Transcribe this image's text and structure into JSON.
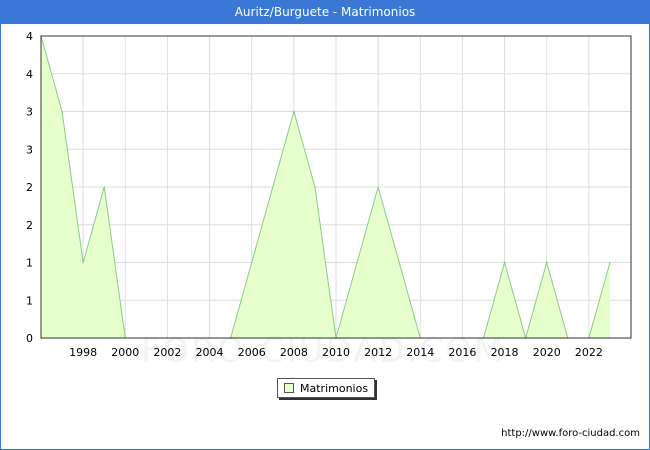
{
  "header": {
    "title": "Auritz/Burguete - Matrimonios"
  },
  "legend": {
    "label": "Matrimonios"
  },
  "footer": {
    "source_url": "http://www.foro-ciudad.com",
    "watermark": "FORO-CIUDAD.COM"
  },
  "colors": {
    "titlebar": "#3a78d6",
    "fill": "#e6ffcc",
    "line": "#88cc88",
    "grid": "#dddddd"
  },
  "chart_data": {
    "type": "area",
    "title": "Auritz/Burguete - Matrimonios",
    "xlabel": "",
    "ylabel": "",
    "x": [
      1996,
      1997,
      1998,
      1999,
      2000,
      2001,
      2002,
      2003,
      2004,
      2005,
      2006,
      2007,
      2008,
      2009,
      2010,
      2011,
      2012,
      2013,
      2014,
      2015,
      2016,
      2017,
      2018,
      2019,
      2020,
      2021,
      2022,
      2023
    ],
    "series": [
      {
        "name": "Matrimonios",
        "values": [
          4,
          3,
          1,
          2,
          0,
          0,
          0,
          0,
          0,
          0,
          1,
          2,
          3,
          2,
          0,
          1,
          2,
          1,
          0,
          0,
          0,
          0,
          1,
          0,
          1,
          0,
          0,
          1
        ]
      }
    ],
    "xlim": [
      1996,
      2024
    ],
    "ylim": [
      0,
      4
    ],
    "x_ticks": [
      "1998",
      "2000",
      "2002",
      "2004",
      "2006",
      "2008",
      "2010",
      "2012",
      "2014",
      "2016",
      "2018",
      "2020",
      "2022"
    ],
    "y_tick_labels": [
      "0",
      "1",
      "1",
      "2",
      "2",
      "3",
      "3",
      "4",
      "4"
    ],
    "grid": true,
    "legend_position": "bottom-center"
  }
}
